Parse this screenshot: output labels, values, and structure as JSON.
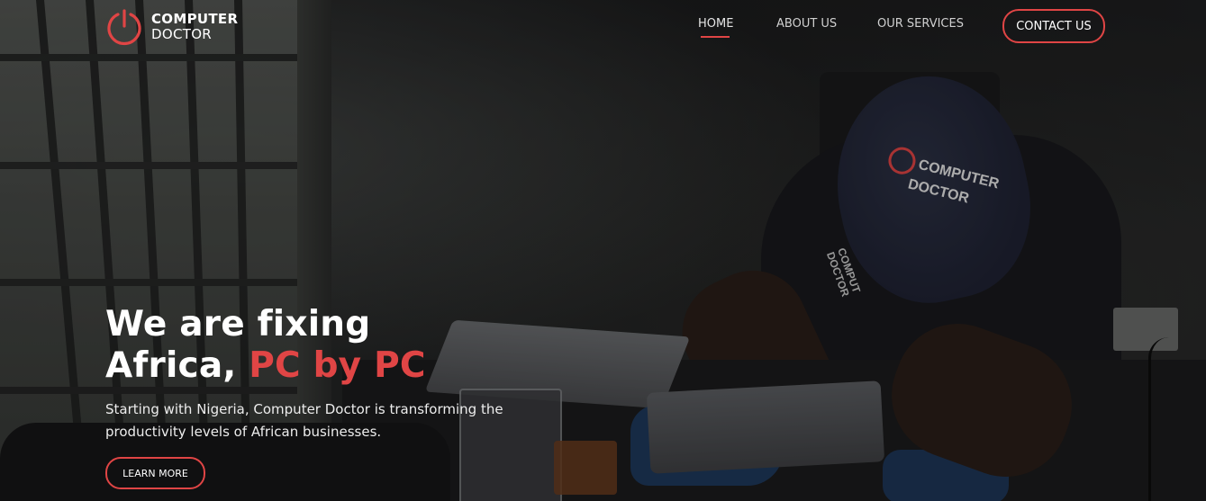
{
  "brand": {
    "name_line1": "COMPUTER",
    "name_line2": "DOCTOR",
    "logo_icon": "power-icon",
    "accent_color": "#e04545"
  },
  "nav": {
    "items": [
      {
        "label": "HOME",
        "active": true
      },
      {
        "label": "ABOUT US",
        "active": false
      },
      {
        "label": "OUR SERVICES",
        "active": false
      }
    ],
    "contact_label": "CONTACT US"
  },
  "hero": {
    "headline_line1": "We are fixing",
    "headline_line2_plain": "Africa, ",
    "headline_line2_accent": "PC by PC",
    "subtext": "Starting with Nigeria, Computer Doctor is transforming the productivity levels of African businesses.",
    "cta_label": "LEARN MORE",
    "photo_cap_text_1": "COMPUTER",
    "photo_cap_text_2": "DOCTOR",
    "photo_shirt_text_1": "COMPUT",
    "photo_shirt_text_2": "DOCTOR"
  }
}
